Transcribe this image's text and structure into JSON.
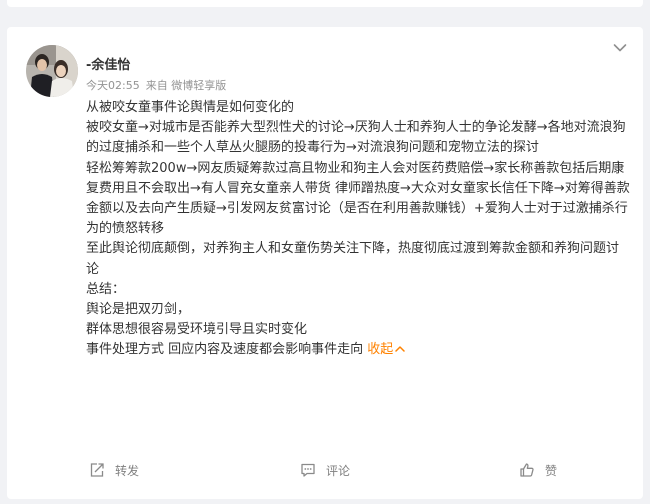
{
  "previous_post": {
    "actions": [
      "",
      "",
      "",
      ""
    ]
  },
  "post": {
    "author": "-余佳怡",
    "time": "今天02:55",
    "source": "来自 微博轻享版",
    "paragraphs": [
      "从被咬女童事件论舆情是如何变化的",
      "被咬女童→对城市是否能养大型烈性犬的讨论→厌狗人士和养狗人士的争论发酵→各地对流浪狗的过度捕杀和一些个人草丛火腿肠的投毒行为→对流浪狗问题和宠物立法的探讨",
      "轻松筹筹款200w→网友质疑筹款过高且物业和狗主人会对医药费赔偿→家长称善款包括后期康复费用且不会取出→有人冒充女童亲人带货 律师蹭热度→大众对女童家长信任下降→对筹得善款金额以及去向产生质疑→引发网友贫富讨论（是否在利用善款赚钱）+爱狗人士对于过激捕杀行为的愤怒转移",
      "至此舆论彻底颠倒，对养狗主人和女童伤势关注下降，热度彻底过渡到筹款金额和养狗问题讨论",
      "总结：",
      "舆论是把双刃剑，",
      "群体思想很容易受环境引导且实时变化"
    ],
    "last_line": "事件处理方式 回应内容及速度都会影响事件走向",
    "collapse_label": "收起"
  },
  "actions": {
    "repost": "转发",
    "comment": "评论",
    "like": "赞"
  },
  "colors": {
    "background": "#f1f2f5",
    "card": "#ffffff",
    "text": "#333333",
    "muted": "#939393",
    "accent": "#ff8200"
  }
}
